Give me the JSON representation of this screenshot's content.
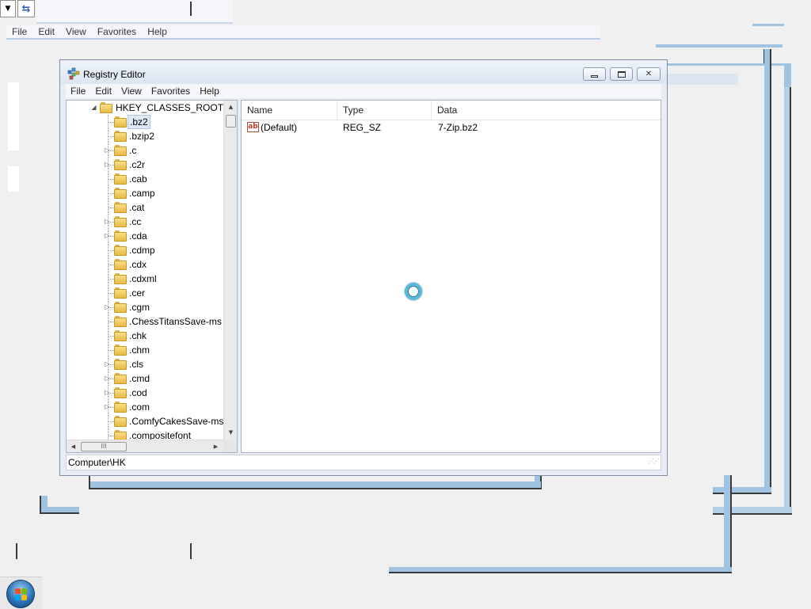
{
  "background": {
    "menu": [
      "File",
      "Edit",
      "View",
      "Favorites",
      "Help"
    ]
  },
  "window": {
    "title": "Registry Editor",
    "menu": [
      "File",
      "Edit",
      "View",
      "Favorites",
      "Help"
    ],
    "caption_buttons": {
      "minimize": "▭",
      "maximize": "□",
      "close": "✕"
    }
  },
  "tree": {
    "root": "HKEY_CLASSES_ROOT",
    "items": [
      {
        "label": ".bz2",
        "expandable": false,
        "selected": true
      },
      {
        "label": ".bzip2",
        "expandable": false
      },
      {
        "label": ".c",
        "expandable": true
      },
      {
        "label": ".c2r",
        "expandable": true
      },
      {
        "label": ".cab",
        "expandable": false
      },
      {
        "label": ".camp",
        "expandable": false
      },
      {
        "label": ".cat",
        "expandable": false
      },
      {
        "label": ".cc",
        "expandable": true
      },
      {
        "label": ".cda",
        "expandable": true
      },
      {
        "label": ".cdmp",
        "expandable": false
      },
      {
        "label": ".cdx",
        "expandable": false
      },
      {
        "label": ".cdxml",
        "expandable": false
      },
      {
        "label": ".cer",
        "expandable": false
      },
      {
        "label": ".cgm",
        "expandable": true
      },
      {
        "label": ".ChessTitansSave-ms",
        "expandable": false
      },
      {
        "label": ".chk",
        "expandable": false
      },
      {
        "label": ".chm",
        "expandable": false
      },
      {
        "label": ".cls",
        "expandable": true
      },
      {
        "label": ".cmd",
        "expandable": true
      },
      {
        "label": ".cod",
        "expandable": true
      },
      {
        "label": ".com",
        "expandable": true
      },
      {
        "label": ".ComfyCakesSave-ms",
        "expandable": false
      },
      {
        "label": ".compositefont",
        "expandable": false
      }
    ],
    "hscroll_thumb": "III"
  },
  "list": {
    "columns": [
      "Name",
      "Type",
      "Data"
    ],
    "rows": [
      {
        "icon": "string-value-icon",
        "icon_text": "ab",
        "name": "(Default)",
        "type": "REG_SZ",
        "data": "7-Zip.bz2"
      }
    ]
  },
  "status": {
    "path": "Computer\\HK"
  },
  "colors": {
    "selection": "#dfe9f5",
    "window_frame": "#e6edf5",
    "ghost_accent": "#9fc3e0"
  }
}
